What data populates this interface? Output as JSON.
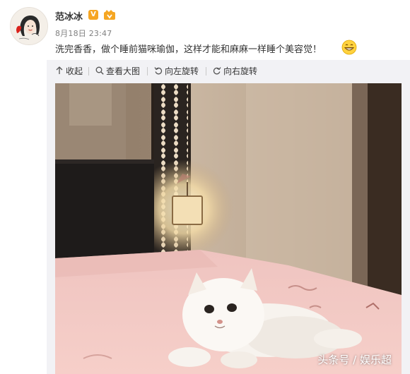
{
  "post": {
    "author": {
      "name": "范冰冰",
      "avatar_icon": "avatar-portrait-icon",
      "verified_icon": "verified-v-icon",
      "member_icon": "member-crown-icon"
    },
    "time": "8月18日 23:47",
    "text": "洗完香香，做个睡前猫咪瑜伽，这样才能和麻麻一样睡个美容觉！",
    "emoji_icon": "grin-emoji-icon"
  },
  "toolbar": {
    "collapse": "收起",
    "view_large": "查看大图",
    "rotate_left": "向左旋转",
    "rotate_right": "向右旋转"
  },
  "photo": {
    "watermark": "头条号 / 娱乐超"
  },
  "colors": {
    "verified_badge": "#f6a623",
    "text": "#333333",
    "meta": "#808080",
    "panel": "#f2f2f5"
  }
}
